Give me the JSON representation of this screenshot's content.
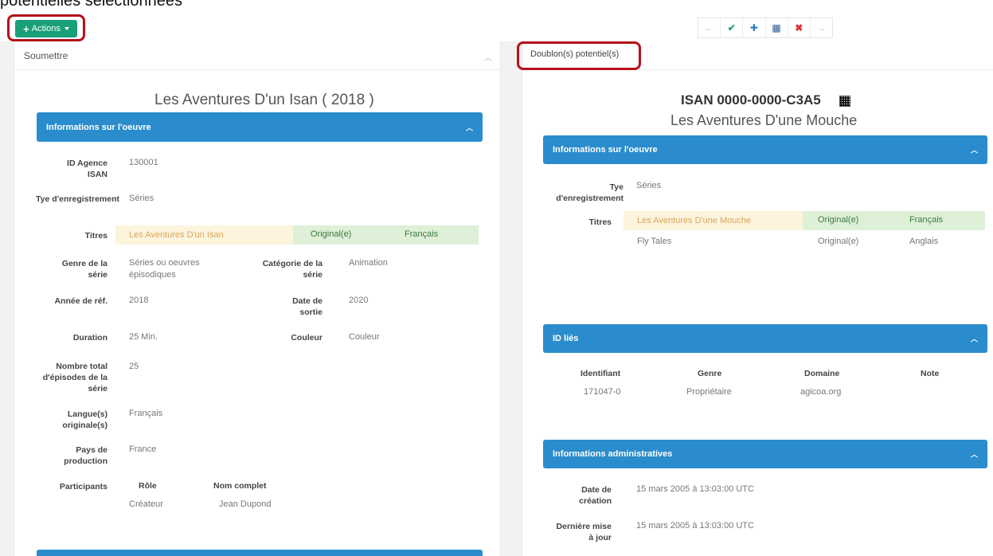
{
  "caption": "potentielles sélectionnées",
  "actions": {
    "plus": "+",
    "label": "Actions"
  },
  "toolbar": {
    "prev": "←",
    "check": "✔",
    "add": "✚",
    "grid": "▦",
    "close": "✖",
    "next": "→"
  },
  "left": {
    "header": "Soumettre",
    "work_title": "Les Aventures D'un Isan ( 2018 )",
    "section1": "Informations sur l'oeuvre",
    "id_agence_label": "ID Agence ISAN",
    "id_agence": "130001",
    "type_label": "Tye d'enregistrement",
    "type": "Séries",
    "titres_label": "Titres",
    "title_value": "Les Aventures D'un Isan",
    "title_kind": "Original(e)",
    "title_lang": "Français",
    "genre_label": "Genre de la série",
    "genre": "Séries ou oeuvres épisodiques",
    "categorie_label": "Catégorie de la série",
    "categorie": "Animation",
    "annee_label": "Année de réf.",
    "annee": "2018",
    "sortie_label": "Date de sortie",
    "sortie": "2020",
    "duration_label": "Duration",
    "duration": "25 Min.",
    "couleur_label": "Couleur",
    "couleur": "Couleur",
    "episodes_label": "Nombre total d'épisodes de la série",
    "episodes": "25",
    "langue_label": "Langue(s) originale(s)",
    "langue": "Français",
    "pays_label": "Pays de production",
    "pays": "France",
    "participants_label": "Participants",
    "role_head": "Rôle",
    "nom_head": "Nom complet",
    "role": "Créateur",
    "nom": "Jean Dupond"
  },
  "right": {
    "tab": "Doublon(s) potentiel(s)",
    "isan": "ISAN 0000-0000-C3A5",
    "work_title": "Les Aventures D'une Mouche",
    "section1": "Informations sur l'oeuvre",
    "type_label": "Tye d'enregistrement",
    "type": "Séries",
    "titres_label": "Titres",
    "title1": "Les Aventures D'une Mouche",
    "title1_kind": "Original(e)",
    "title1_lang": "Français",
    "title2": "Fly Tales",
    "title2_kind": "Original(e)",
    "title2_lang": "Anglais",
    "section2": "ID liés",
    "cols": [
      "Identifiant",
      "Genre",
      "Domaine",
      "Note"
    ],
    "row": [
      "171047-0",
      "Propriétaire",
      "agicoa.org",
      ""
    ],
    "section3": "Informations administratives",
    "creation_label": "Date de création",
    "creation": "15 mars 2005 à 13:03:00 UTC",
    "maj_label": "Dernière mise à jour",
    "maj": "15 mars 2005 à 13:03:00 UTC"
  },
  "colors": {
    "accent": "#2a8ccc",
    "actions": "#1aa079",
    "highlight": "#b5121b"
  }
}
